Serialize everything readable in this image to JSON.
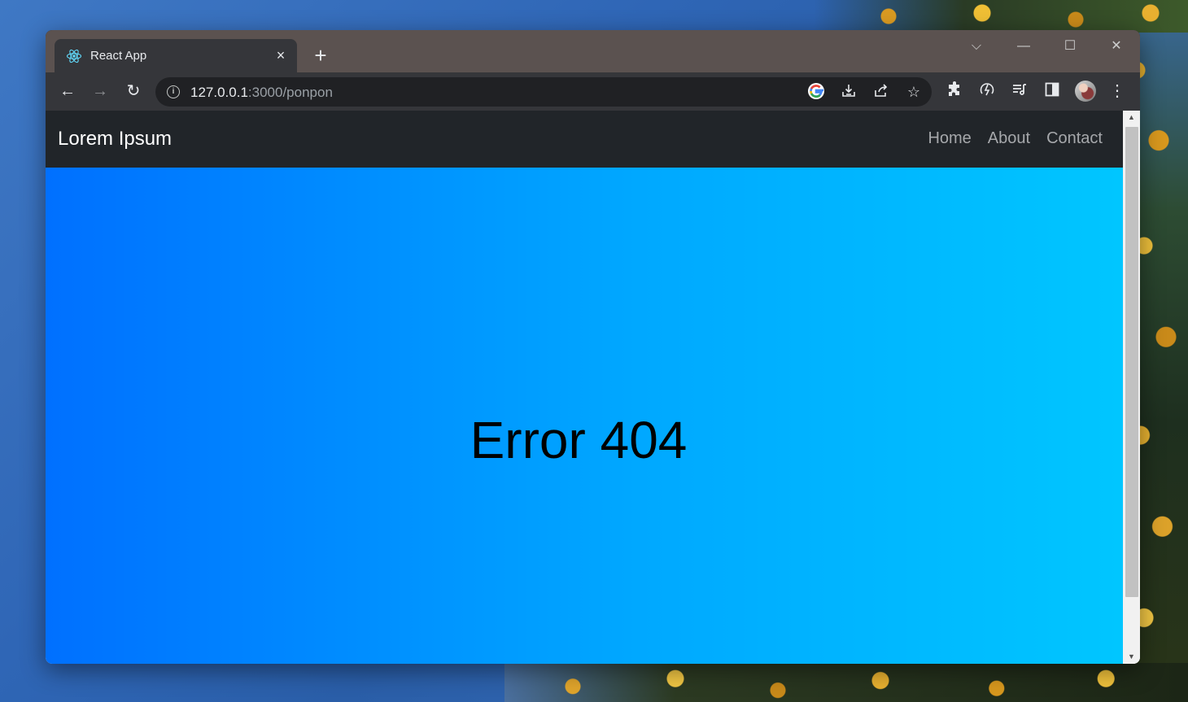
{
  "browser": {
    "tab": {
      "title": "React App",
      "close_icon": "×"
    },
    "new_tab_icon": "+",
    "window_controls": {
      "tab_search": "⌵",
      "minimize": "—",
      "maximize": "☐",
      "close": "✕"
    },
    "toolbar": {
      "back": "←",
      "forward": "→",
      "reload": "↻",
      "url_host": "127.0.0.1",
      "url_rest": ":3000/ponpon"
    }
  },
  "page": {
    "brand": "Lorem Ipsum",
    "nav": [
      "Home",
      "About",
      "Contact"
    ],
    "error": "Error 404"
  },
  "colors": {
    "navbar": "#212529",
    "gradient_start": "#0070ff",
    "gradient_end": "#00c6ff"
  },
  "icons": [
    "react-logo-icon",
    "google-icon",
    "install-icon",
    "share-icon",
    "bookmark-star-icon",
    "extensions-icon",
    "extension-bolt-icon",
    "reading-list-icon",
    "side-panel-icon",
    "profile-avatar",
    "more-menu-icon"
  ]
}
